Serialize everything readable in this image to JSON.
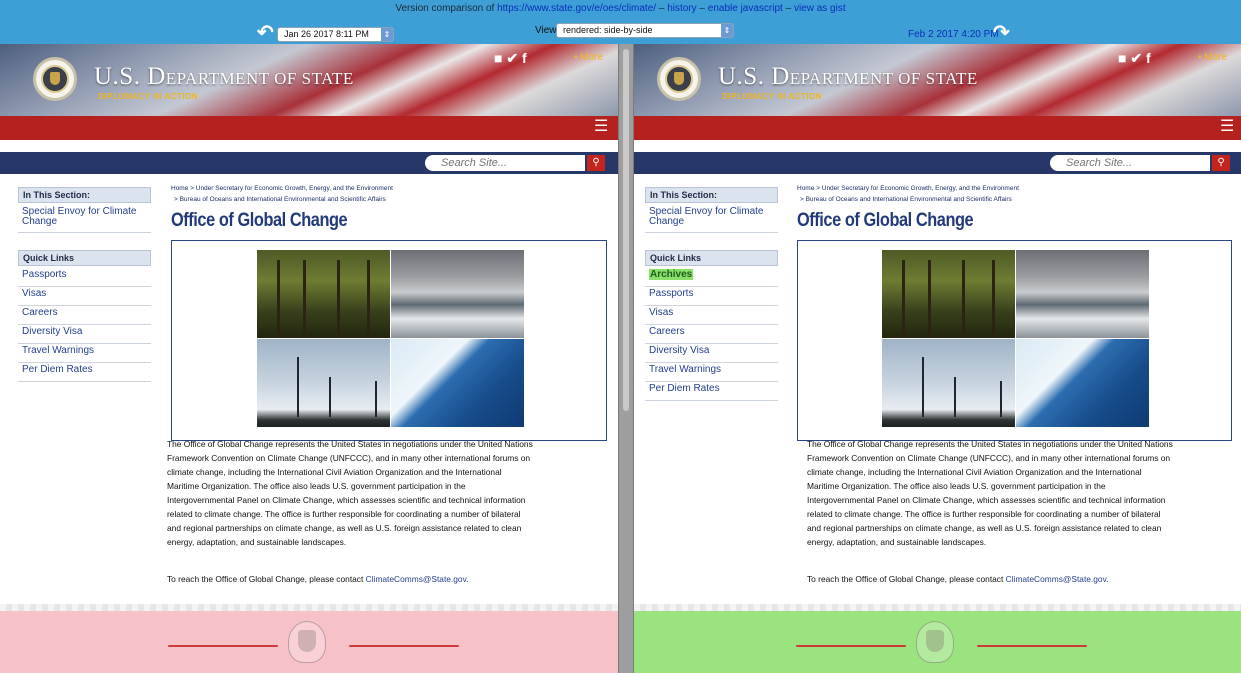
{
  "toolbar": {
    "prefix": "Version comparison of ",
    "url": "https://www.state.gov/e/oes/climate/",
    "sep1": " – ",
    "history": "history",
    "sep2": " – ",
    "enable_js": "enable javascript",
    "sep3": " – ",
    "view_gist": "view as gist",
    "left_date": "Jan 26 2017 8:11 PM",
    "view_label": "View",
    "view_value": "rendered: side-by-side",
    "right_date": "Feb 2 2017 4:20 PM"
  },
  "site": {
    "dept_us": "U.S. D",
    "dept_epartment": "EPARTMENT",
    "dept_of": " OF ",
    "dept_state": "STATE",
    "tagline": "DIPLOMACY IN ACTION",
    "social_icons": "■ ✔ f",
    "more": "• More",
    "menu_icon": "☰",
    "search_placeholder": "Search Site...",
    "search_icon": "🔍"
  },
  "left": {
    "in_this_section": "In This Section:",
    "section_link": "Special Envoy for Climate Change",
    "quick_links_head": "Quick Links",
    "quick_links": [
      "Passports",
      "Visas",
      "Careers",
      "Diversity Visa",
      "Travel Warnings",
      "Per Diem Rates"
    ]
  },
  "right": {
    "in_this_section": "In This Section:",
    "section_link": "Special Envoy for Climate Change",
    "quick_links_head": "Quick Links",
    "quick_links": [
      "Archives",
      "Passports",
      "Visas",
      "Careers",
      "Diversity Visa",
      "Travel Warnings",
      "Per Diem Rates"
    ]
  },
  "page": {
    "crumb1": "Home > Under Secretary for Economic Growth, Energy, and the Environment",
    "crumb2": "> Bureau of Oceans and International Environmental and Scientific Affairs",
    "title": "Office of Global Change",
    "para_lines": [
      "The Office of Global Change represents the United States in negotiations under the United Nations",
      "Framework Convention on Climate Change (UNFCCC), and in many other international forums on",
      "climate change, including the International Civil Aviation Organization and the International",
      "Maritime Organization.  The office also leads U.S. government participation in the",
      "Intergovernmental Panel on Climate Change, which assesses scientific and technical information",
      "related to climate change.  The office is further responsible for coordinating a number of bilateral",
      "and regional partnerships on climate change, as well as U.S. foreign assistance related to clean",
      "energy, adaptation, and sustainable landscapes."
    ],
    "contact_prefix": "To reach the Office of Global Change, please contact ",
    "contact_email": "ClimateComms@State.gov",
    "contact_suffix": "."
  },
  "colors": {
    "toolbar_bg": "#3d9fd6",
    "left_footer": "#f7c1c8",
    "right_footer": "#9be37f",
    "red_bar": "#b5211f",
    "search_bar": "#263768"
  }
}
